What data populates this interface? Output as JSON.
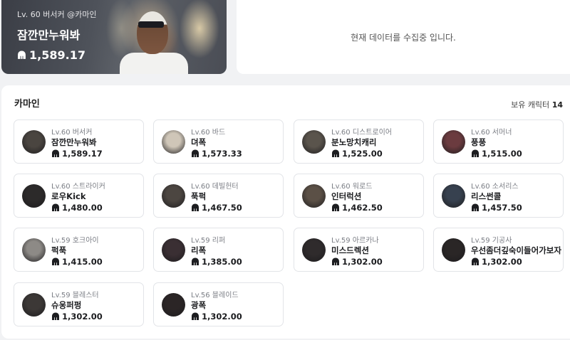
{
  "hero": {
    "subtitle": "Lv. 60 버서커 @카마인",
    "name": "잠깐만누워봐",
    "item_level": "1,589.17"
  },
  "status_message": "현재 데이터를 수집중 입니다.",
  "server": {
    "name": "카마인",
    "count_label": "보유 캐릭터",
    "count": "14"
  },
  "characters": [
    {
      "lv": "Lv.60 버서커",
      "name": "잠깐만누워봐",
      "ilvl": "1,589.17",
      "avatar_color": "#4a4540"
    },
    {
      "lv": "Lv.60 바드",
      "name": "뎌폭",
      "ilvl": "1,573.33",
      "avatar_color": "#cfc6b8"
    },
    {
      "lv": "Lv.60 디스트로이어",
      "name": "분노망치캐리",
      "ilvl": "1,525.00",
      "avatar_color": "#5a544c"
    },
    {
      "lv": "Lv.60 서머너",
      "name": "풍풍",
      "ilvl": "1,515.00",
      "avatar_color": "#6b3b3f"
    },
    {
      "lv": "Lv.60 스트라이커",
      "name": "로우Kick",
      "ilvl": "1,480.00",
      "avatar_color": "#2c2a2a"
    },
    {
      "lv": "Lv.60 데빌헌터",
      "name": "푹퍽",
      "ilvl": "1,467.50",
      "avatar_color": "#4c4641"
    },
    {
      "lv": "Lv.60 워로드",
      "name": "인터럭션",
      "ilvl": "1,462.50",
      "avatar_color": "#5b5046"
    },
    {
      "lv": "Lv.60 소서리스",
      "name": "리스썬콜",
      "ilvl": "1,457.50",
      "avatar_color": "#37414f"
    },
    {
      "lv": "Lv.59 호크아이",
      "name": "퍽푹",
      "ilvl": "1,415.00",
      "avatar_color": "#8d8a86"
    },
    {
      "lv": "Lv.59 리퍼",
      "name": "리폭",
      "ilvl": "1,385.00",
      "avatar_color": "#3a2f33"
    },
    {
      "lv": "Lv.59 아르카나",
      "name": "미스드렉션",
      "ilvl": "1,302.00",
      "avatar_color": "#2f2b2c"
    },
    {
      "lv": "Lv.59 기공사",
      "name": "우선좀더깊숙이들어가보자",
      "ilvl": "1,302.00",
      "avatar_color": "#2a2626"
    },
    {
      "lv": "Lv.59 블레스터",
      "name": "슈웅퍼펑",
      "ilvl": "1,302.00",
      "avatar_color": "#3c3836"
    },
    {
      "lv": "Lv.56 블레이드",
      "name": "광폭",
      "ilvl": "1,302.00",
      "avatar_color": "#2b2526"
    }
  ]
}
